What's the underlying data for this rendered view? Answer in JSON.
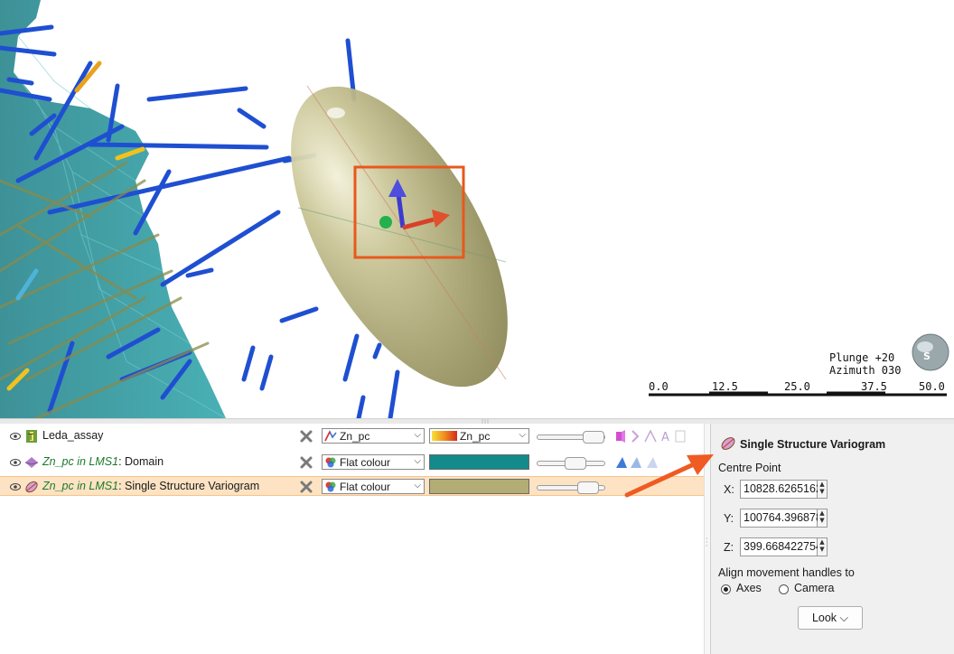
{
  "viewport": {
    "compass": {
      "plunge": "Plunge +20",
      "azimuth": "Azimuth 030",
      "icon": "orientation-globe-icon"
    },
    "scale_bar": {
      "ticks": [
        "0.0",
        "12.5",
        "25.0",
        "37.5",
        "50.0"
      ]
    }
  },
  "scene_list": {
    "rows": [
      {
        "name_plain": "Leda_assay",
        "name_italic": "",
        "name_suffix": "",
        "icon": "drillhole-icon",
        "colour_mode": "Zn_pc",
        "colour_value": "Zn_pc",
        "selected": false,
        "colour_swatch": "gradient"
      },
      {
        "name_plain": "",
        "name_italic": "Zn_pc in LMS1",
        "name_suffix": ": Domain",
        "icon": "domain-mesh-icon",
        "colour_mode": "Flat colour",
        "colour_value": "",
        "selected": false,
        "colour_swatch": "#138a8c"
      },
      {
        "name_plain": "",
        "name_italic": "Zn_pc in LMS1",
        "name_suffix": ": Single Structure Variogram",
        "icon": "variogram-ellipsoid-icon",
        "colour_mode": "Flat colour",
        "colour_value": "",
        "selected": true,
        "colour_swatch": "#b2ad75"
      }
    ]
  },
  "properties": {
    "title": "Single Structure Variogram",
    "centre_point_label": "Centre Point",
    "x_label": "X:",
    "x_value": "10828.6265162",
    "y_label": "Y:",
    "y_value": "100764.396878",
    "z_label": "Z:",
    "z_value": "399.668422754",
    "align_label": "Align movement handles to",
    "option_axes": "Axes",
    "option_camera": "Camera",
    "selected_option": "Axes",
    "look_button": "Look"
  },
  "colors": {
    "selection_row": "#fde3c3",
    "ellipsoid": "#b6b17a",
    "domain": "#1a8f93",
    "highlight_box": "#e8581c",
    "arrow": "#ef5b22"
  }
}
